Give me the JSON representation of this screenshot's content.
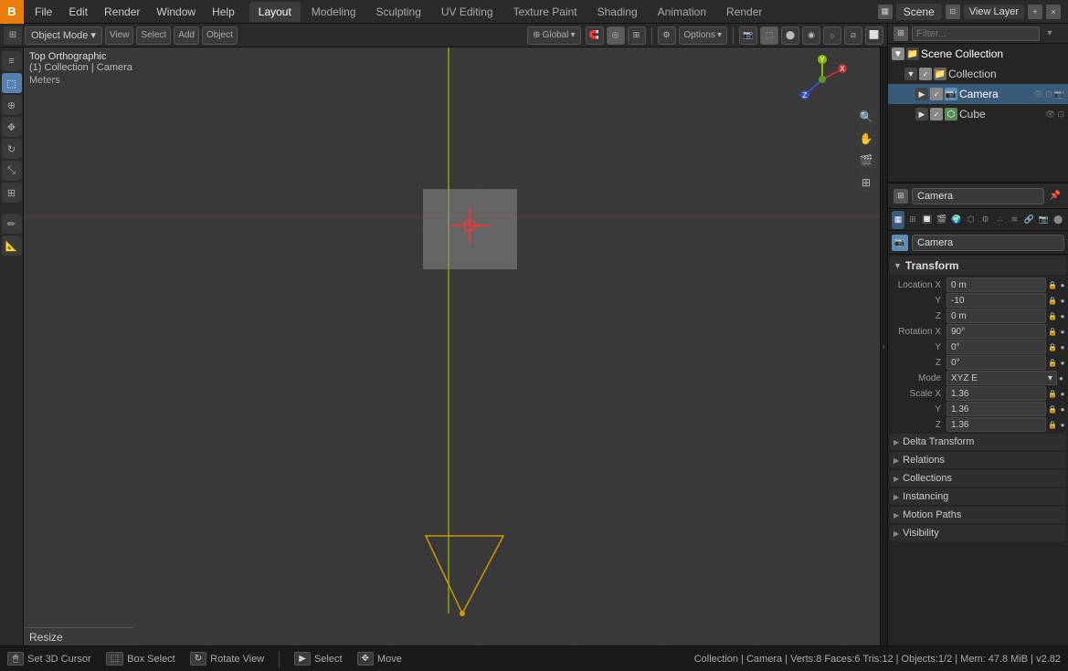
{
  "app": {
    "title": "Blender",
    "logo": "B",
    "version": "v2.82"
  },
  "menu": {
    "items": [
      "File",
      "Edit",
      "Render",
      "Window",
      "Help"
    ]
  },
  "tabs": [
    {
      "label": "Layout",
      "active": true
    },
    {
      "label": "Modeling"
    },
    {
      "label": "Sculpting"
    },
    {
      "label": "UV Editing"
    },
    {
      "label": "Texture Paint"
    },
    {
      "label": "Shading"
    },
    {
      "label": "Animation"
    },
    {
      "label": "Render"
    }
  ],
  "scene": {
    "name": "Scene",
    "view_layer": "View Layer"
  },
  "viewport": {
    "title": "Top Orthographic",
    "subtitle": "(1) Collection | Camera",
    "info": "Meters",
    "mode": "Object Mode",
    "global": "Global"
  },
  "outliner": {
    "title": "Outliner",
    "search_placeholder": "Filter...",
    "items": [
      {
        "label": "Scene Collection",
        "type": "scene",
        "indent": 0,
        "expanded": true
      },
      {
        "label": "Collection",
        "type": "collection",
        "indent": 1,
        "expanded": true
      },
      {
        "label": "Camera",
        "type": "camera",
        "indent": 2,
        "selected": true
      },
      {
        "label": "Cube",
        "type": "mesh",
        "indent": 2
      }
    ]
  },
  "properties": {
    "object_name": "Camera",
    "object_data_name": "Camera",
    "sections": {
      "transform": {
        "title": "Transform",
        "location": {
          "x": "0 m",
          "y": "-10",
          "z": "0 m"
        },
        "rotation": {
          "x": "90°",
          "y": "0°",
          "z": "0°"
        },
        "scale": {
          "x": "1.36",
          "y": "1.36",
          "z": "1.36"
        },
        "mode": "XYZ E"
      },
      "delta_transform": "Delta Transform",
      "relations": "Relations",
      "collections": "Collections",
      "instancing": "Instancing",
      "motion_paths": "Motion Paths",
      "visibility": "Visibility"
    }
  },
  "status_bar": {
    "cursor": "Set 3D Cursor",
    "box_select": "Box Select",
    "rotate_view": "Rotate View",
    "select": "Select",
    "move": "Move",
    "stats": "Collection | Camera | Verts:8  Faces:6  Tris:12 | Objects:1/2 | Mem: 47.8 MiB | v2.82"
  },
  "resize_handle": "Resize",
  "icons": {
    "arrow_right": "▶",
    "arrow_down": "▼",
    "search": "🔍",
    "eye": "👁",
    "camera": "📷",
    "mesh": "⬡",
    "collection": "📁",
    "scene": "🎬",
    "lock": "🔒",
    "dot": "●",
    "chevron_down": "▾",
    "pin": "📌",
    "move": "✥",
    "cursor": "⊕",
    "box": "⬚",
    "rotate": "↻",
    "axis_x": "X",
    "axis_y": "Y",
    "axis_z": "Z"
  }
}
